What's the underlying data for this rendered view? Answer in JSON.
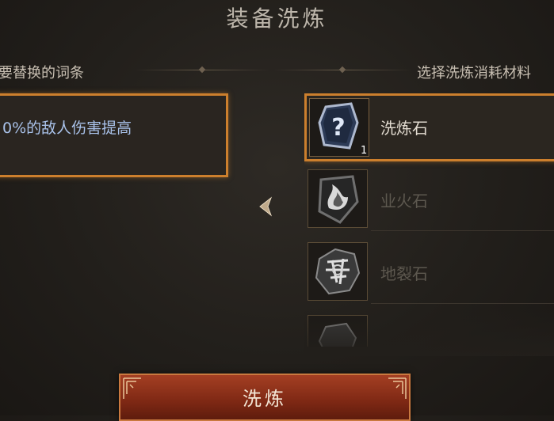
{
  "screen": {
    "title": "装备洗炼"
  },
  "left_panel": {
    "header": "要替换的词条",
    "affix_text": "0%的敌人伤害提高"
  },
  "right_panel": {
    "header": "选择洗炼消耗材料",
    "materials": [
      {
        "name": "洗炼石",
        "count": "1",
        "icon": "rune-question-icon",
        "selected": true
      },
      {
        "name": "业火石",
        "count": "",
        "icon": "flame-rune-icon",
        "selected": false
      },
      {
        "name": "地裂石",
        "count": "",
        "icon": "earth-rune-icon",
        "selected": false
      }
    ]
  },
  "actions": {
    "refine_label": "洗炼"
  },
  "colors": {
    "accent": "#cc7f2d",
    "affix_text": "#a9c2ea",
    "button": "#8f3219"
  }
}
